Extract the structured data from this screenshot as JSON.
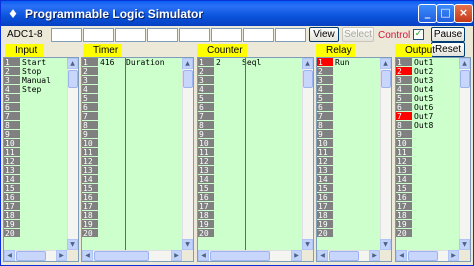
{
  "window": {
    "title": "Programmable Logic Simulator",
    "minimize": "_",
    "maximize": "□",
    "close": "×",
    "app_icon": "♦"
  },
  "toolbar": {
    "adc_label": "ADC1-8",
    "view": "View",
    "select": "Select",
    "control_label": "Control",
    "control_checked": "✓",
    "pause": "Pause",
    "reset": "Reset"
  },
  "headers": {
    "input": "Input",
    "timer": "Timer",
    "counter": "Counter",
    "relay": "Relay",
    "output": "Output"
  },
  "input": {
    "rows": [
      "1",
      "2",
      "3",
      "4",
      "5",
      "6",
      "7",
      "8",
      "9",
      "10",
      "11",
      "12",
      "13",
      "14",
      "15",
      "16",
      "17",
      "18",
      "19",
      "20"
    ],
    "labels": [
      "Start",
      "Stop",
      "Manual",
      "Step"
    ]
  },
  "timer": {
    "rows": [
      "1",
      "2",
      "3",
      "4",
      "5",
      "6",
      "7",
      "8",
      "9",
      "10",
      "11",
      "12",
      "13",
      "14",
      "15",
      "16",
      "17",
      "18",
      "19",
      "20"
    ],
    "value": "416",
    "label": "Duration"
  },
  "counter": {
    "rows": [
      "1",
      "2",
      "3",
      "4",
      "5",
      "6",
      "7",
      "8",
      "9",
      "10",
      "11",
      "12",
      "13",
      "14",
      "15",
      "16",
      "17",
      "18",
      "19",
      "20"
    ],
    "value": "2",
    "label": "Seql"
  },
  "relay": {
    "rows": [
      "1",
      "2",
      "3",
      "4",
      "5",
      "6",
      "7",
      "8",
      "9",
      "10",
      "11",
      "12",
      "13",
      "14",
      "15",
      "16",
      "17",
      "18",
      "19",
      "20"
    ],
    "label": "Run",
    "active": [
      1
    ]
  },
  "output": {
    "rows": [
      "1",
      "2",
      "3",
      "4",
      "5",
      "6",
      "7",
      "8",
      "9",
      "10",
      "11",
      "12",
      "13",
      "14",
      "15",
      "16",
      "17",
      "18",
      "19",
      "20"
    ],
    "labels": [
      "Out1",
      "Out2",
      "Out3",
      "Out4",
      "Out5",
      "Out6",
      "Out7",
      "Out8"
    ],
    "active": [
      2,
      7
    ]
  },
  "scroll": {
    "up": "▲",
    "down": "▼",
    "left": "◀",
    "right": "▶"
  }
}
